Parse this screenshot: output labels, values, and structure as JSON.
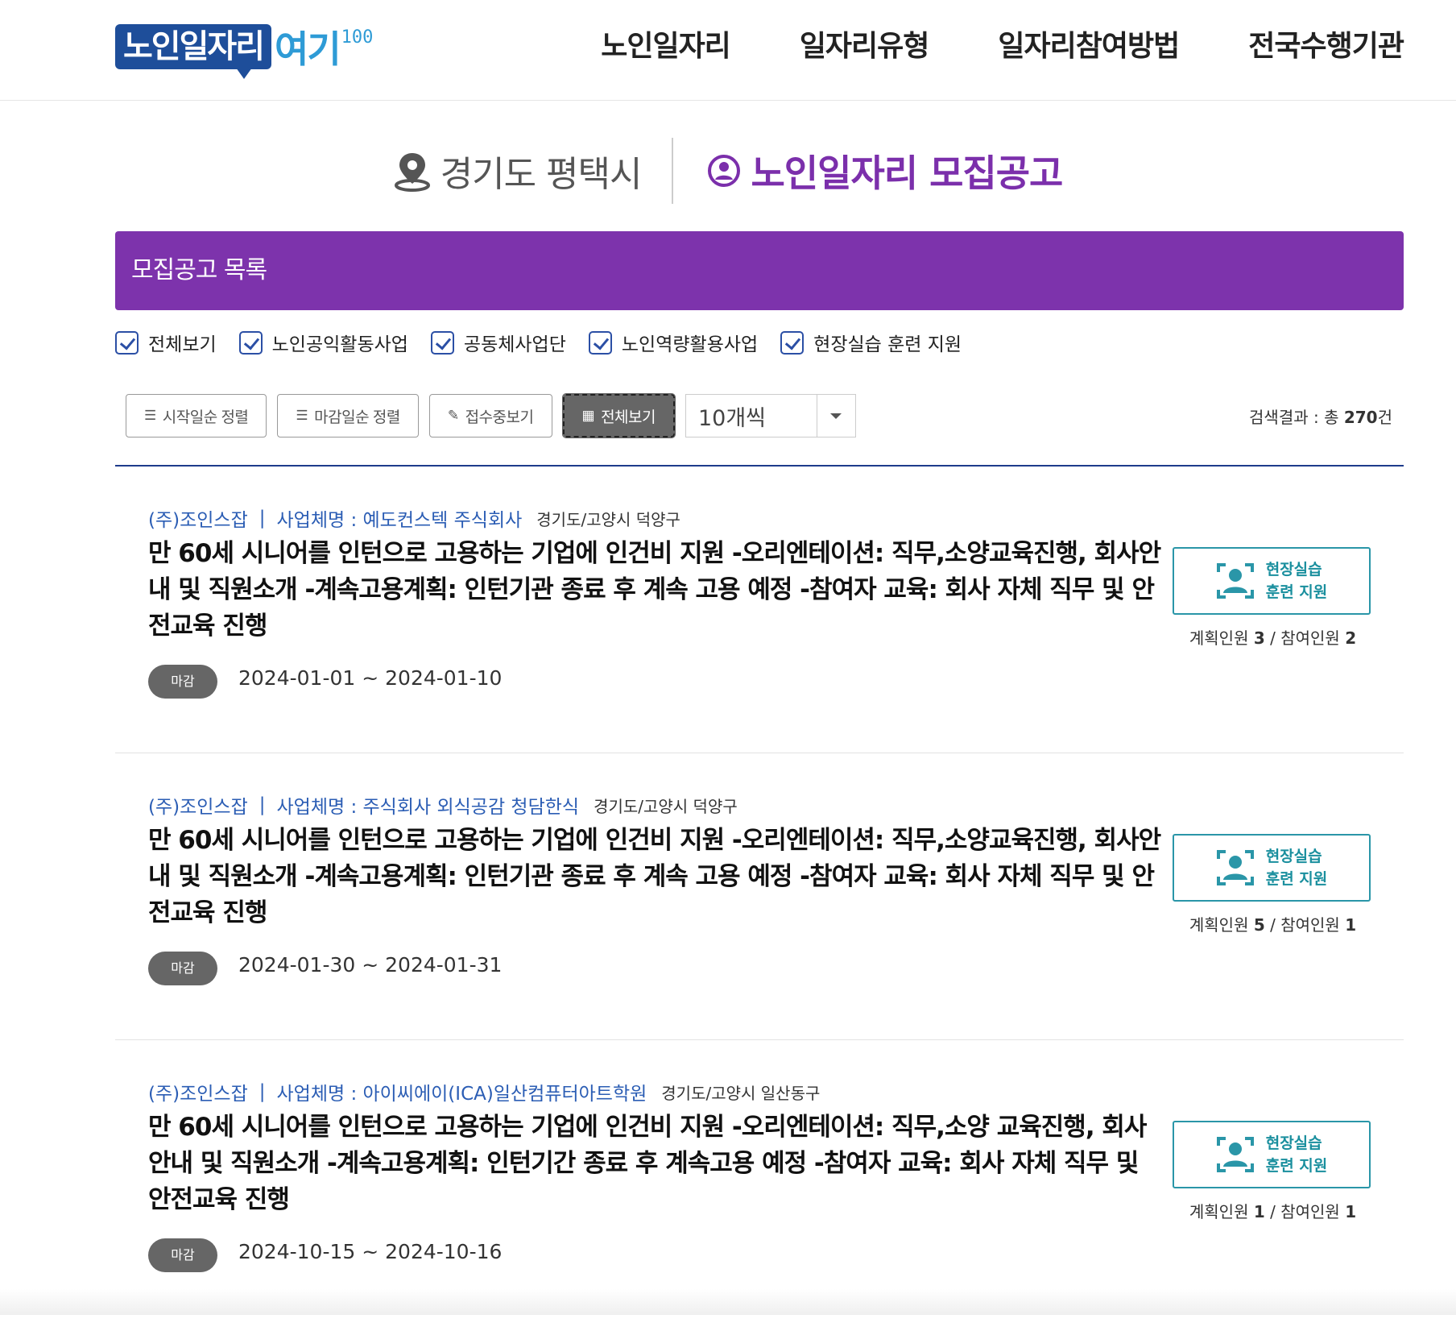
{
  "header": {
    "logo_text": "노인일자리",
    "logo_accent": "여기",
    "logo_mark": "100",
    "nav": [
      "노인일자리",
      "일자리유형",
      "일자리참여방법",
      "전국수행기관"
    ]
  },
  "title": {
    "location": "경기도 평택시",
    "heading": "노인일자리 모집공고"
  },
  "list_bar": {
    "label": "모집공고 목록"
  },
  "filters": [
    "전체보기",
    "노인공익활동사업",
    "공동체사업단",
    "노인역량활용사업",
    "현장실습 훈련 지원"
  ],
  "toolbar": {
    "sort_start": "시작일순 정렬",
    "sort_end": "마감일순 정렬",
    "receiving": "접수중보기",
    "view_all": "전체보기",
    "page_size": "10개씩",
    "result_prefix": "검색결과 : 총 ",
    "result_count": "270",
    "result_suffix": "건"
  },
  "items": [
    {
      "org": "(주)조인스잡",
      "business": "사업체명 : 예도컨스텍 주식회사",
      "region": "경기도/고양시 덕양구",
      "title": "만 60세 시니어를 인턴으로 고용하는 기업에 인건비 지원 -오리엔테이션: 직무,소양교육진행, 회사안내 및 직원소개 -계속고용계획: 인턴기관 종료 후 계속 고용 예정 -참여자 교육: 회사 자체 직무 및 안전교육 진행",
      "status": "마감",
      "period": "2024-01-01 ~ 2024-01-10",
      "badge_line1": "현장실습",
      "badge_line2": "훈련 지원",
      "planned_label": "계획인원",
      "planned": "3",
      "joined_label": "참여인원",
      "joined": "2"
    },
    {
      "org": "(주)조인스잡",
      "business": "사업체명 : 주식회사 외식공감 청담한식",
      "region": "경기도/고양시 덕양구",
      "title": "만 60세 시니어를 인턴으로 고용하는 기업에 인건비 지원 -오리엔테이션: 직무,소양교육진행, 회사안내 및 직원소개 -계속고용계획: 인턴기관 종료 후 계속 고용 예정 -참여자 교육: 회사 자체 직무 및 안전교육 진행",
      "status": "마감",
      "period": "2024-01-30 ~ 2024-01-31",
      "badge_line1": "현장실습",
      "badge_line2": "훈련 지원",
      "planned_label": "계획인원",
      "planned": "5",
      "joined_label": "참여인원",
      "joined": "1"
    },
    {
      "org": "(주)조인스잡",
      "business": "사업체명 : 아이씨에이(ICA)일산컴퓨터아트학원",
      "region": "경기도/고양시 일산동구",
      "title": "만 60세 시니어를 인턴으로 고용하는 기업에 인건비 지원 -오리엔테이션: 직무,소양 교육진행, 회사안내 및 직원소개 -계속고용계획: 인턴기간 종료 후 계속고용 예정 -참여자 교육: 회사 자체 직무 및 안전교육 진행",
      "status": "마감",
      "period": "2024-10-15 ~ 2024-10-16",
      "badge_line1": "현장실습",
      "badge_line2": "훈련 지원",
      "planned_label": "계획인원",
      "planned": "1",
      "joined_label": "참여인원",
      "joined": "1"
    }
  ],
  "colors": {
    "primary_purple": "#7d33ac",
    "brand_blue": "#1e4e9a",
    "link_blue": "#2b5db4",
    "badge_teal": "#2a96a8"
  },
  "icons": [
    "location-pin-icon",
    "person-circle-icon",
    "checkbox-checked-icon",
    "list-icon",
    "pencil-icon",
    "grid-icon",
    "caret-down-icon",
    "person-frame-icon"
  ]
}
